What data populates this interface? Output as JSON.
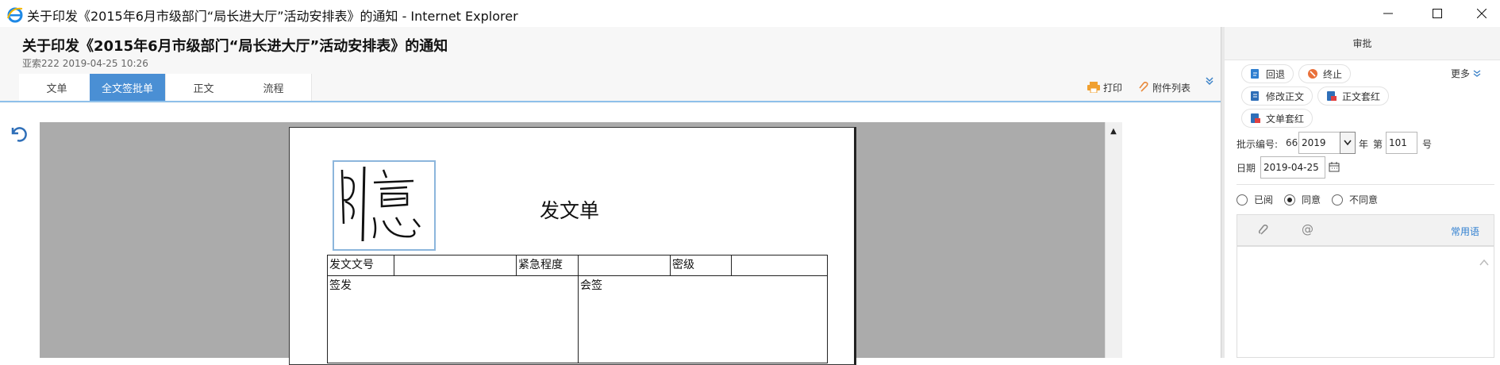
{
  "window": {
    "title": "关于印发《2015年6月市级部门“局长进大厅”活动安排表》的通知 - Internet Explorer",
    "controls": [
      "minimize",
      "maximize",
      "close"
    ]
  },
  "header": {
    "title": "关于印发《2015年6月市级部门“局长进大厅”活动安排表》的通知",
    "meta": "亚索222 2019-04-25 10:26",
    "tabs": [
      {
        "label": "文单",
        "active": false
      },
      {
        "label": "全文签批单",
        "active": true
      },
      {
        "label": "正文",
        "active": false
      },
      {
        "label": "流程",
        "active": false
      }
    ],
    "print_label": "打印",
    "attachments_label": "附件列表"
  },
  "document": {
    "form_title": "发文单",
    "row1": [
      "发文文号",
      "",
      "紧急程度",
      "",
      "密级",
      ""
    ],
    "sign_label": "签发",
    "countersign_label": "会签"
  },
  "approval": {
    "title": "审批",
    "actions": {
      "return": "回退",
      "stop": "终止",
      "edit_text": "修改正文",
      "text_redhead": "正文套红",
      "doc_redhead": "文单套红"
    },
    "more_label": "更多",
    "number_label": "批示编号:",
    "number_prefix": "66",
    "year_value": "2019",
    "year_label": "年",
    "seq_label": "第",
    "seq_value": "101",
    "hao_label": "号",
    "date_label": "日期",
    "date_value": "2019-04-25",
    "radios": [
      {
        "label": "已阅",
        "checked": false
      },
      {
        "label": "同意",
        "checked": true
      },
      {
        "label": "不同意",
        "checked": false
      }
    ],
    "common_phrases": "常用语"
  },
  "colors": {
    "accent": "#4a8fd4",
    "link": "#2f7fd0",
    "canvas_gray": "#ababab"
  }
}
